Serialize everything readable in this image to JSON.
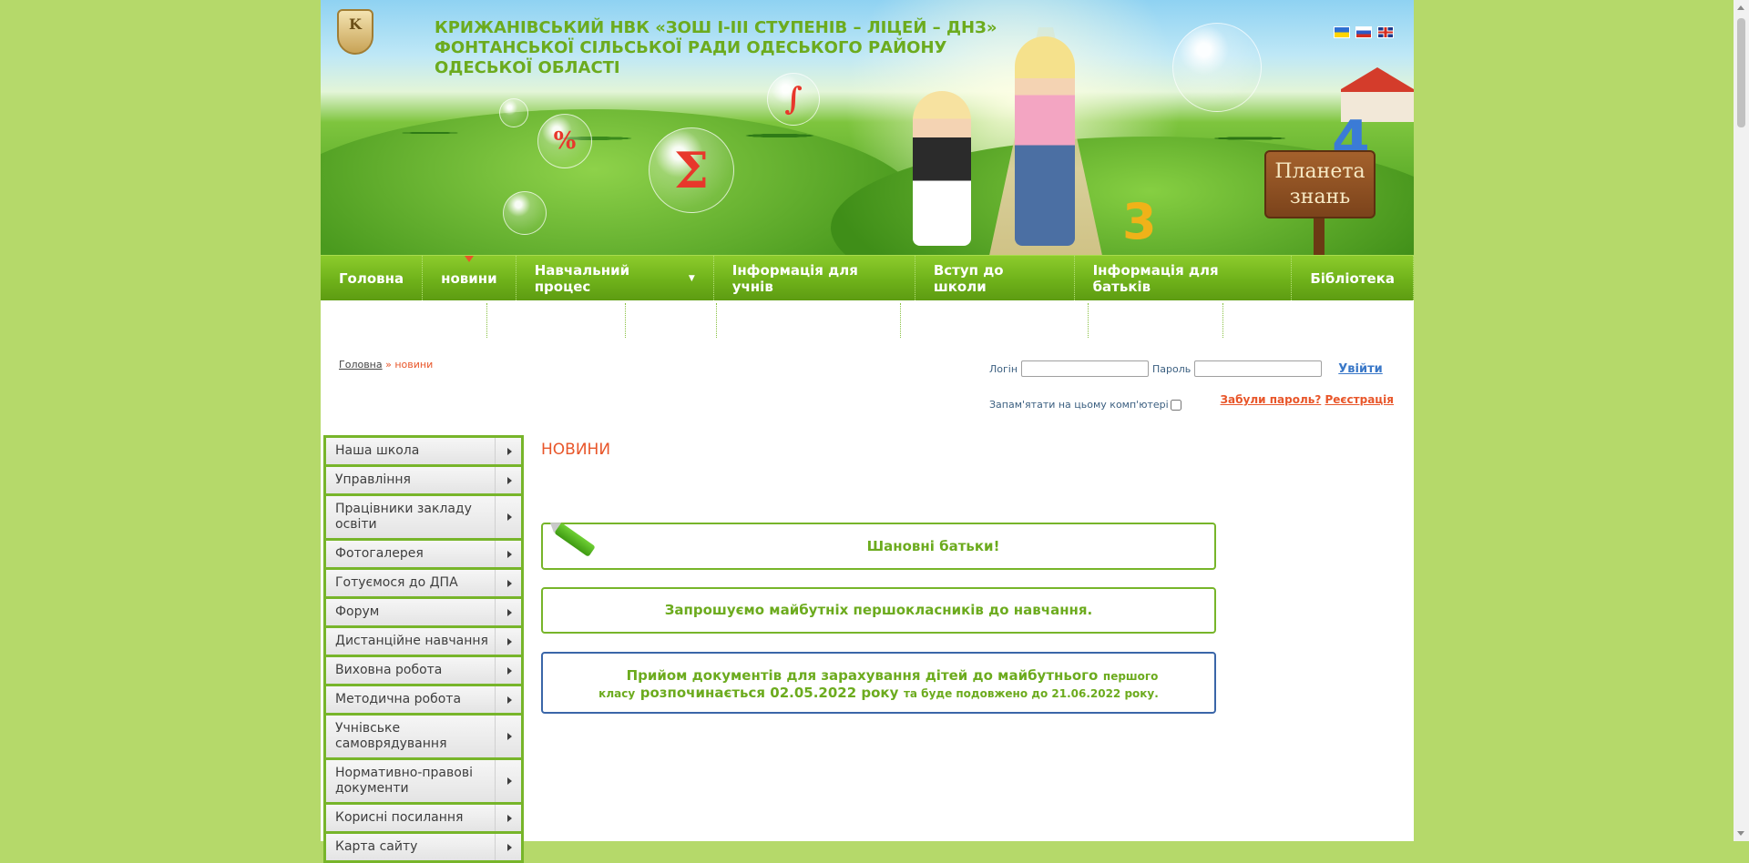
{
  "header": {
    "site_title": "КРИЖАНІВСЬКИЙ НВК «ЗОШ І-ІІІ СТУПЕНІВ – ЛІЦЕЙ – ДНЗ» ФОНТАНСЬКОЇ СІЛЬСЬКОЇ РАДИ ОДЕСЬКОГО РАЙОНУ ОДЕСЬКОЇ ОБЛАСТІ",
    "logo_letter": "K",
    "sign_text_line1": "Планета",
    "sign_text_line2": "знань",
    "bubble_percent": "%",
    "bubble_sigma": "Σ",
    "bubble_integral": "∫",
    "digit_4": "4",
    "digit_3": "3"
  },
  "languages": [
    "uk",
    "ru",
    "en"
  ],
  "nav": {
    "items": [
      {
        "label": "Головна"
      },
      {
        "label": "новини",
        "active": true
      },
      {
        "label": "Навчальний процес",
        "has_dropdown": true
      },
      {
        "label": "Інформація для учнів"
      },
      {
        "label": "Вступ до школи"
      },
      {
        "label": "Інформація для батьків"
      },
      {
        "label": "Бібліотека"
      }
    ]
  },
  "breadcrumb": {
    "home": "Головна",
    "separator": "»",
    "current": "новини"
  },
  "login": {
    "login_label": "Логін",
    "password_label": "Пароль",
    "login_value": "",
    "password_value": "",
    "enter_label": "Увійти",
    "forgot_label": "Забули пароль?",
    "register_label": "Реєстрація",
    "remember_label": "Запам'ятати на цьому комп'ютері"
  },
  "sidebar": {
    "items": [
      {
        "label": "Наша школа"
      },
      {
        "label": "Управління"
      },
      {
        "label": "Працівники закладу освіти"
      },
      {
        "label": "Фотогалерея"
      },
      {
        "label": "Готуємося до ДПА"
      },
      {
        "label": "Форум"
      },
      {
        "label": "Дистанційне навчання"
      },
      {
        "label": "Виховна робота"
      },
      {
        "label": "Методична робота"
      },
      {
        "label": "Учнівське самоврядування"
      },
      {
        "label": "Нормативно-правові документи"
      },
      {
        "label": "Корисні посилання"
      },
      {
        "label": "Карта сайту"
      }
    ]
  },
  "main": {
    "title": "НОВИНИ",
    "news": [
      {
        "text": "Шановні батьки!"
      },
      {
        "text": "Запрошуємо майбутніх першокласників до навчання."
      },
      {
        "text_line1_big": "Прийом документів для зарахування дітей до майбутнього",
        "text_line1_small": "першого",
        "text_line2_small_a": "класу",
        "text_line2_big": "розпочинається 02.05.2022 року",
        "text_line2_small_b": "та буде подовжено до 21.06.2022 року."
      }
    ]
  },
  "colors": {
    "background": "#b5d96a",
    "accent_green": "#6cab1e",
    "accent_orange": "#e8562a",
    "nav_green": "#6fb21a",
    "link_blue": "#3a78c8",
    "border_blue": "#3a66a8"
  }
}
